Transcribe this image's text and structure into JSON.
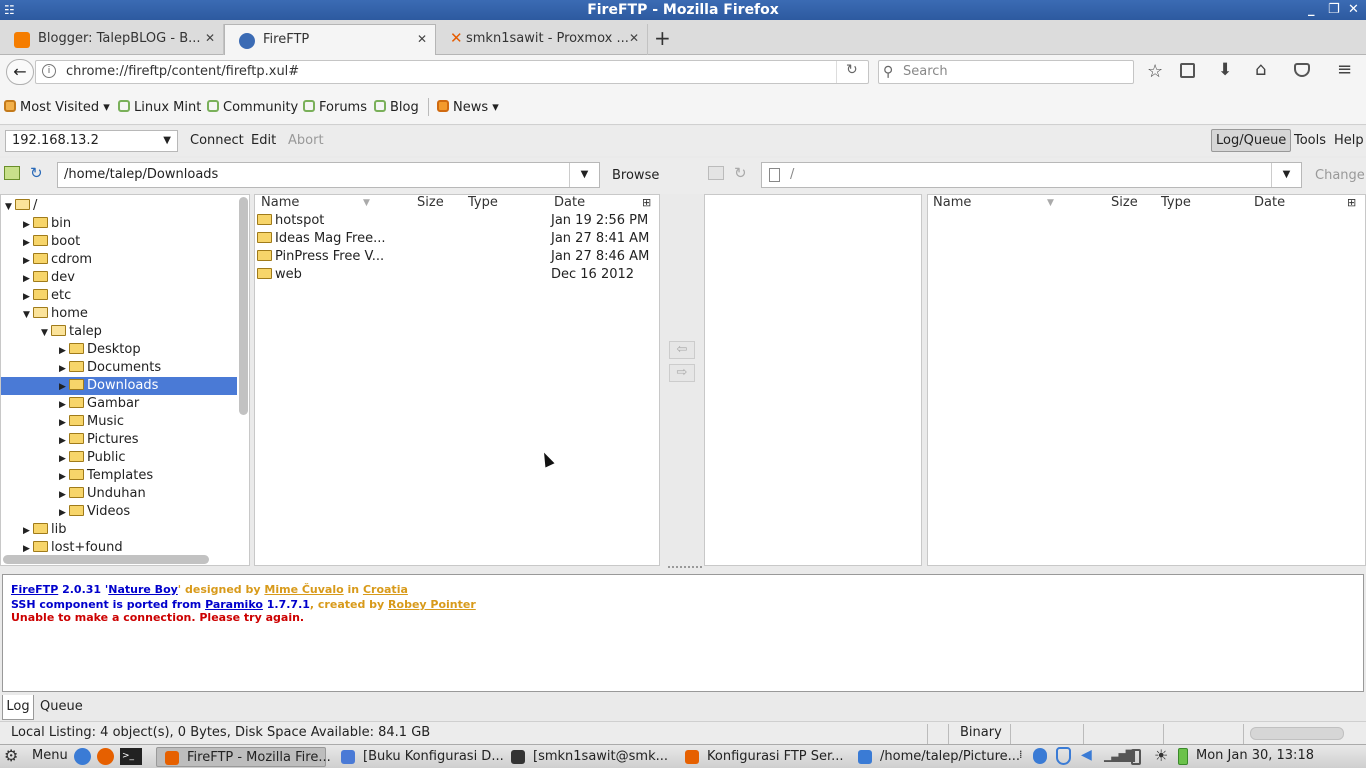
{
  "window": {
    "title": "FireFTP - Mozilla Firefox"
  },
  "tabs": [
    {
      "label": "Blogger: TalepBLOG - B...",
      "icon_color": "#f57d00",
      "active": false
    },
    {
      "label": "FireFTP",
      "icon_color": "#3b6bb4",
      "active": true
    },
    {
      "label": "smkn1sawit - Proxmox ...",
      "icon_color": "#e65c00",
      "active": false
    }
  ],
  "nav": {
    "url": "chrome://fireftp/content/fireftp.xul#",
    "search_placeholder": "Search"
  },
  "bookmarks": [
    {
      "label": "Most Visited"
    },
    {
      "label": "Linux Mint"
    },
    {
      "label": "Community"
    },
    {
      "label": "Forums"
    },
    {
      "label": "Blog"
    },
    {
      "label": "News"
    }
  ],
  "ftp": {
    "host": "192.168.13.2",
    "connect": "Connect",
    "edit": "Edit",
    "abort": "Abort",
    "log_queue": "Log/Queue",
    "tools": "Tools",
    "help": "Help",
    "local_path": "/home/talep/Downloads",
    "browse": "Browse",
    "remote_path": "/",
    "change": "Change"
  },
  "tree": [
    {
      "label": "/",
      "depth": 0,
      "expanded": true
    },
    {
      "label": "bin",
      "depth": 1
    },
    {
      "label": "boot",
      "depth": 1
    },
    {
      "label": "cdrom",
      "depth": 1
    },
    {
      "label": "dev",
      "depth": 1
    },
    {
      "label": "etc",
      "depth": 1
    },
    {
      "label": "home",
      "depth": 1,
      "expanded": true
    },
    {
      "label": "talep",
      "depth": 2,
      "expanded": true
    },
    {
      "label": "Desktop",
      "depth": 3
    },
    {
      "label": "Documents",
      "depth": 3
    },
    {
      "label": "Downloads",
      "depth": 3,
      "selected": true
    },
    {
      "label": "Gambar",
      "depth": 3
    },
    {
      "label": "Music",
      "depth": 3
    },
    {
      "label": "Pictures",
      "depth": 3
    },
    {
      "label": "Public",
      "depth": 3
    },
    {
      "label": "Templates",
      "depth": 3
    },
    {
      "label": "Unduhan",
      "depth": 3
    },
    {
      "label": "Videos",
      "depth": 3
    },
    {
      "label": "lib",
      "depth": 1
    },
    {
      "label": "lost+found",
      "depth": 1
    }
  ],
  "local_columns": {
    "name": "Name",
    "size": "Size",
    "type": "Type",
    "date": "Date"
  },
  "local_files": [
    {
      "name": "hotspot",
      "date": "Jan 19 2:56 PM"
    },
    {
      "name": "Ideas Mag Free...",
      "date": "Jan 27 8:41 AM"
    },
    {
      "name": "PinPress Free V...",
      "date": "Jan 27 8:46 AM"
    },
    {
      "name": "web",
      "date": "Dec 16 2012"
    }
  ],
  "remote_columns": {
    "name": "Name",
    "size": "Size",
    "type": "Type",
    "date": "Date"
  },
  "log": {
    "l1_fireftp": "FireFTP",
    "l1_version": " 2.0.31 '",
    "l1_name": "Nature Boy",
    "l1_designed": "' designed by ",
    "l1_author": "Mime Čuvalo",
    "l1_in": " in ",
    "l1_country": "Croatia",
    "l2_text": "SSH component is ported from ",
    "l2_lib": "Paramiko",
    "l2_ver": " 1.7.7.1",
    "l2_created": ", created by ",
    "l2_author": "Robey Pointer",
    "l3_error": "Unable to make a connection. Please try again."
  },
  "log_tabs": {
    "log": "Log",
    "queue": "Queue"
  },
  "status": {
    "listing": "Local Listing: 4 object(s), 0 Bytes, Disk Space Available: 84.1 GB",
    "mode": "Binary"
  },
  "taskbar": {
    "menu": "Menu",
    "items": [
      {
        "label": "FireFTP - Mozilla Fire...",
        "color": "#e66000"
      },
      {
        "label": "[Buku Konfigurasi D...",
        "color": "#4a7ad6"
      },
      {
        "label": "[smkn1sawit@smk...",
        "color": "#333333"
      },
      {
        "label": "Konfigurasi FTP Ser...",
        "color": "#e66000"
      },
      {
        "label": "/home/talep/Picture...",
        "color": "#3a7bd5"
      }
    ],
    "clock": "Mon Jan 30, 13:18"
  }
}
